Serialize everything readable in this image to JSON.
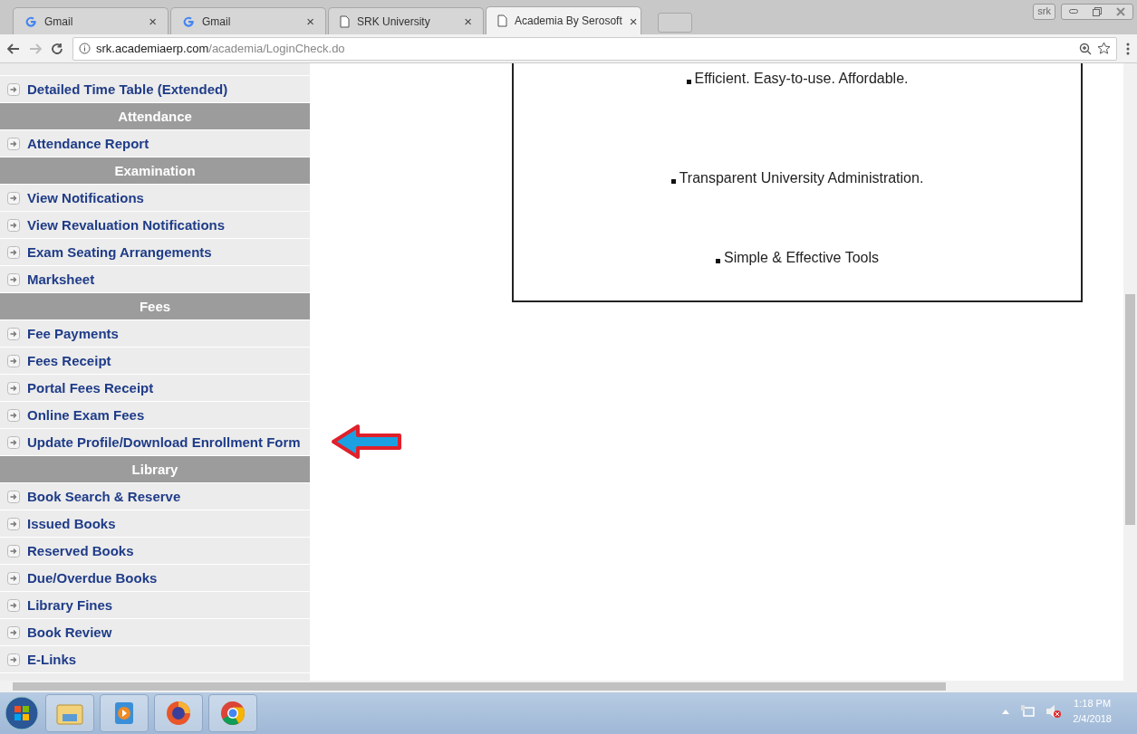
{
  "browser": {
    "tabs": [
      {
        "title": "Gmail",
        "kind": "google",
        "selected": false
      },
      {
        "title": "Gmail",
        "kind": "google",
        "selected": false
      },
      {
        "title": "SRK University",
        "kind": "page",
        "selected": false
      },
      {
        "title": "Academia By Serosoft",
        "kind": "page",
        "selected": true
      }
    ],
    "close_glyph": "×",
    "profile_badge": "srk",
    "url_host": "srk.academiaerp.com",
    "url_path": "/academia/LoginCheck.do"
  },
  "sidebar": {
    "items": [
      {
        "kind": "link",
        "label": "Detailed Time Table (Extended)"
      },
      {
        "kind": "header",
        "label": "Attendance"
      },
      {
        "kind": "link",
        "label": "Attendance Report"
      },
      {
        "kind": "header",
        "label": "Examination"
      },
      {
        "kind": "link",
        "label": "View Notifications"
      },
      {
        "kind": "link",
        "label": "View Revaluation Notifications"
      },
      {
        "kind": "link",
        "label": "Exam Seating Arrangements"
      },
      {
        "kind": "link",
        "label": "Marksheet"
      },
      {
        "kind": "header",
        "label": "Fees"
      },
      {
        "kind": "link",
        "label": "Fee Payments"
      },
      {
        "kind": "link",
        "label": "Fees Receipt"
      },
      {
        "kind": "link",
        "label": "Portal Fees Receipt"
      },
      {
        "kind": "link",
        "label": "Online Exam Fees"
      },
      {
        "kind": "link",
        "label": "Update Profile/Download Enrollment Form",
        "pointed": true
      },
      {
        "kind": "header",
        "label": "Library"
      },
      {
        "kind": "link",
        "label": "Book Search & Reserve"
      },
      {
        "kind": "link",
        "label": "Issued Books"
      },
      {
        "kind": "link",
        "label": "Reserved Books"
      },
      {
        "kind": "link",
        "label": "Due/Overdue Books"
      },
      {
        "kind": "link",
        "label": "Library Fines"
      },
      {
        "kind": "link",
        "label": "Book Review"
      },
      {
        "kind": "link",
        "label": "E-Links"
      }
    ]
  },
  "features": [
    "Efficient. Easy-to-use. Affordable.",
    "Transparent University Administration.",
    "Simple & Effective Tools"
  ],
  "taskbar": {
    "apps": [
      {
        "kind": "explorer"
      },
      {
        "kind": "media-player"
      },
      {
        "kind": "firefox"
      },
      {
        "kind": "chrome"
      }
    ],
    "time": "1:18 PM",
    "date": "2/4/2018"
  }
}
